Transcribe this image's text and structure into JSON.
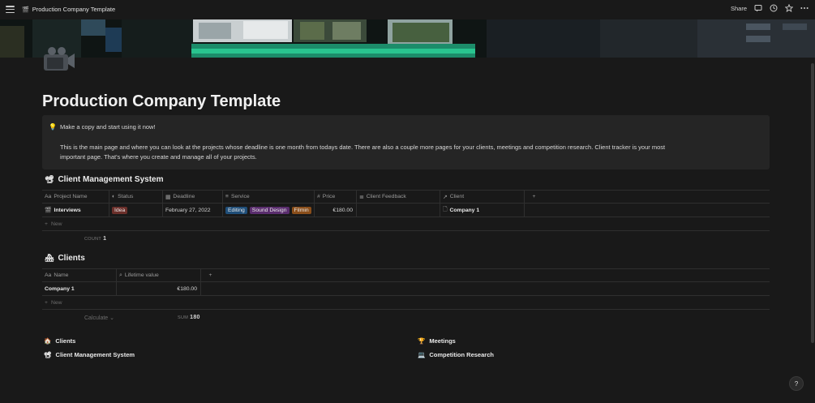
{
  "topbar": {
    "page_icon": "camera-icon",
    "breadcrumb": "Production Company Template",
    "share_label": "Share"
  },
  "page": {
    "title": "Production Company Template",
    "icon": "video-camera-icon"
  },
  "callout": {
    "icon": "lightbulb-icon",
    "line1": "Make a copy and start using it now!",
    "line2": "This is the main page and where you can look at the projects whose deadline is one month from todays date. There are also a couple more pages for your clients, meetings and competition research. Client tracker is your most",
    "line3": "important page. That's where you create and manage all of your projects."
  },
  "cms": {
    "title": "Client Management System",
    "columns": [
      "Project Name",
      "Status",
      "Deadline",
      "Service",
      "Price",
      "Client Feedback",
      "Client"
    ],
    "rows": [
      {
        "project": "Interviews",
        "status": "Idea",
        "deadline": "February 27, 2022",
        "services": [
          "Editing",
          "Sound Design",
          "Filmin"
        ],
        "price": "€180.00",
        "feedback": "",
        "client": "Company 1"
      }
    ],
    "new_label": "New",
    "agg_label": "COUNT",
    "agg_value": "1"
  },
  "clients": {
    "title": "Clients",
    "columns": [
      "Name",
      "Lifetime value"
    ],
    "rows": [
      {
        "name": "Company 1",
        "value": "€180.00"
      }
    ],
    "new_label": "New",
    "calculate_label": "Calculate",
    "agg_label": "SUM",
    "agg_value": "180"
  },
  "links": [
    {
      "label": "Clients",
      "icon": "house-icon"
    },
    {
      "label": "Client Management System",
      "icon": "film-icon"
    },
    {
      "label": "Meetings",
      "icon": "trophy-icon"
    },
    {
      "label": "Competition Research",
      "icon": "laptop-icon"
    }
  ],
  "help_label": "?"
}
